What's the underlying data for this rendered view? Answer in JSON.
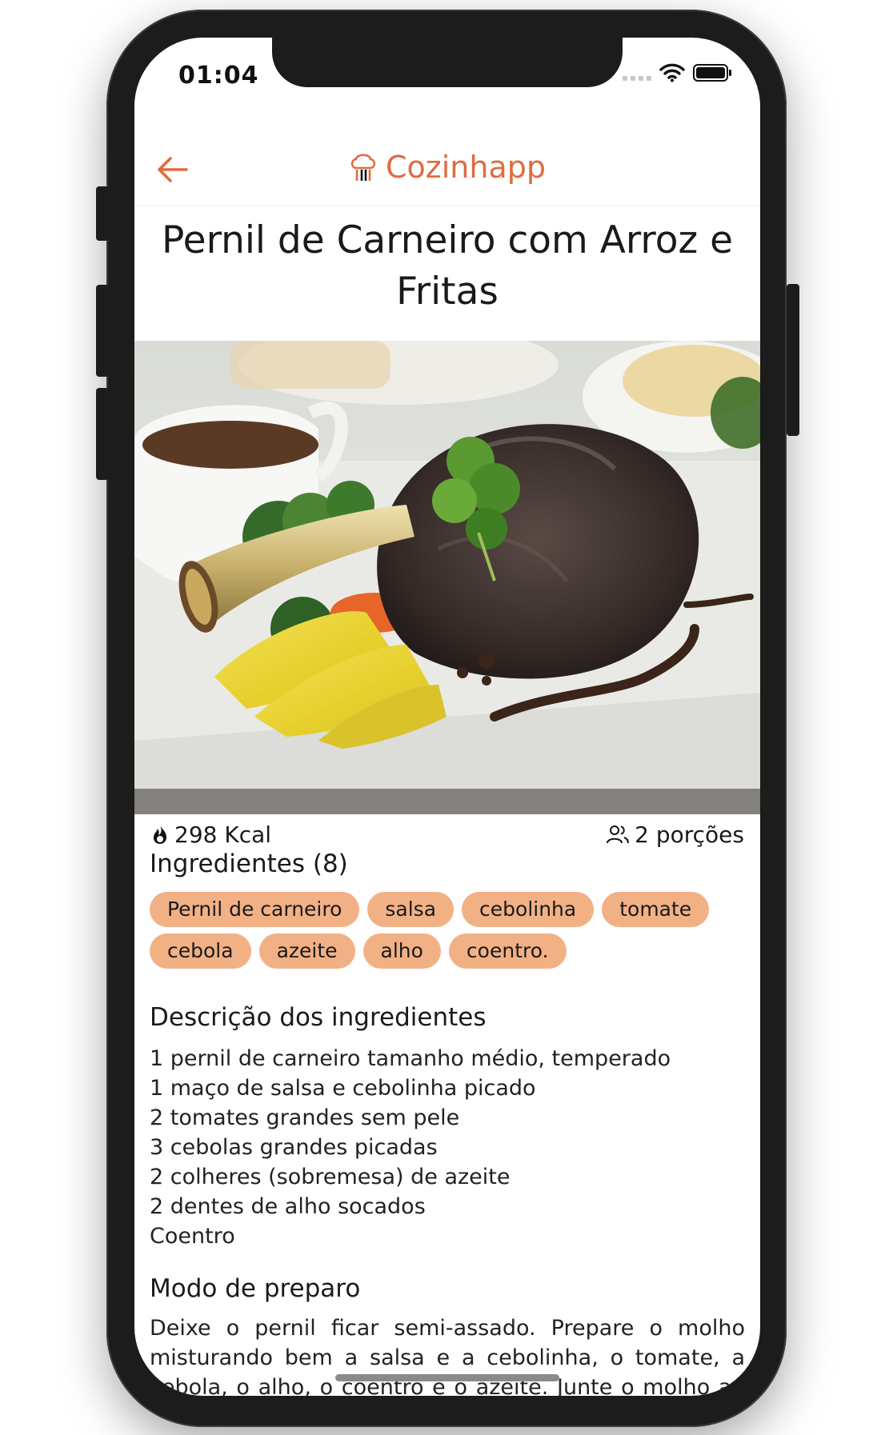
{
  "status": {
    "time": "01:04"
  },
  "header": {
    "brand": "Cozinhapp"
  },
  "recipe": {
    "title": "Pernil de Carneiro com Arroz e Fritas",
    "calories": "298 Kcal",
    "servings": "2 porções"
  },
  "ingredients": {
    "heading": "Ingredientes (8)",
    "tags": [
      "Pernil de carneiro",
      "salsa",
      "cebolinha",
      "tomate",
      "cebola",
      "azeite",
      "alho",
      "coentro."
    ]
  },
  "description": {
    "heading": "Descrição dos ingredientes",
    "lines": [
      "1 pernil de carneiro tamanho médio, temperado",
      "1 maço de salsa e cebolinha picado",
      "2 tomates grandes sem pele",
      "3 cebolas grandes picadas",
      "2 colheres (sobremesa) de azeite",
      "2 dentes de alho socados",
      "Coentro"
    ]
  },
  "preparation": {
    "heading": "Modo de preparo",
    "text": "Deixe o pernil ficar semi-assado. Prepare o molho misturando bem a salsa e a cebolinha, o tomate, a cebola, o alho, o coentro e o azeite. Junte o molho ao carneiro"
  },
  "colors": {
    "accent": "#e06b3f",
    "chip": "#f2b185"
  },
  "icons": {
    "back": "arrow-left-icon",
    "brand": "chef-hat-icon",
    "calories": "flame-icon",
    "servings": "users-icon"
  }
}
